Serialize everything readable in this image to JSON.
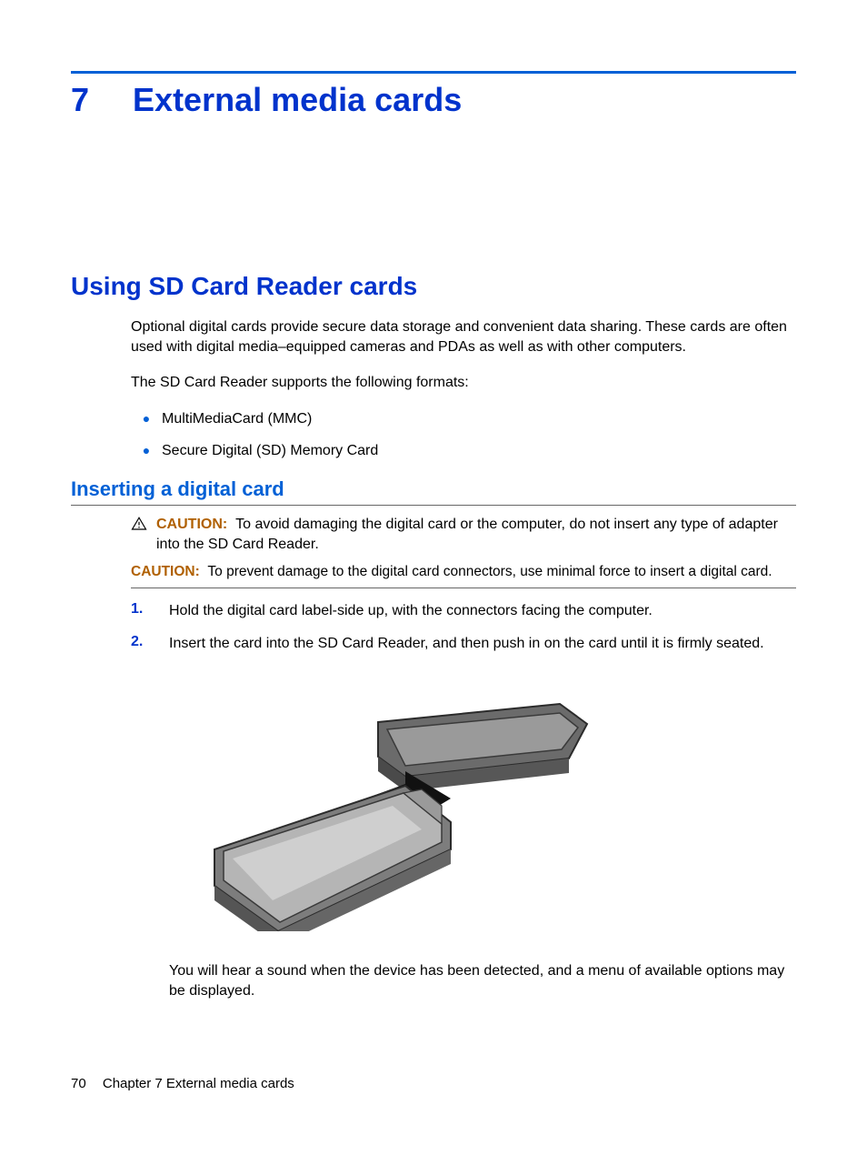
{
  "chapter": {
    "number": "7",
    "title": "External media cards"
  },
  "h2": "Using SD Card Reader cards",
  "para1": "Optional digital cards provide secure data storage and convenient data sharing. These cards are often used with digital media–equipped cameras and PDAs as well as with other computers.",
  "para2": "The SD Card Reader supports the following formats:",
  "bullets": [
    "MultiMediaCard (MMC)",
    "Secure Digital (SD) Memory Card"
  ],
  "h3": "Inserting a digital card",
  "caution1": {
    "label": "CAUTION:",
    "text": "To avoid damaging the digital card or the computer, do not insert any type of adapter into the SD Card Reader."
  },
  "caution2": {
    "label": "CAUTION:",
    "text": "To prevent damage to the digital card connectors, use minimal force to insert a digital card."
  },
  "steps": [
    "Hold the digital card label-side up, with the connectors facing the computer.",
    "Insert the card into the SD Card Reader, and then push in on the card until it is firmly seated."
  ],
  "step_numbers": [
    "1.",
    "2."
  ],
  "after_figure": "You will hear a sound when the device has been detected, and a menu of available options may be displayed.",
  "footer": {
    "page": "70",
    "chapter_label": "Chapter 7   External media cards"
  }
}
